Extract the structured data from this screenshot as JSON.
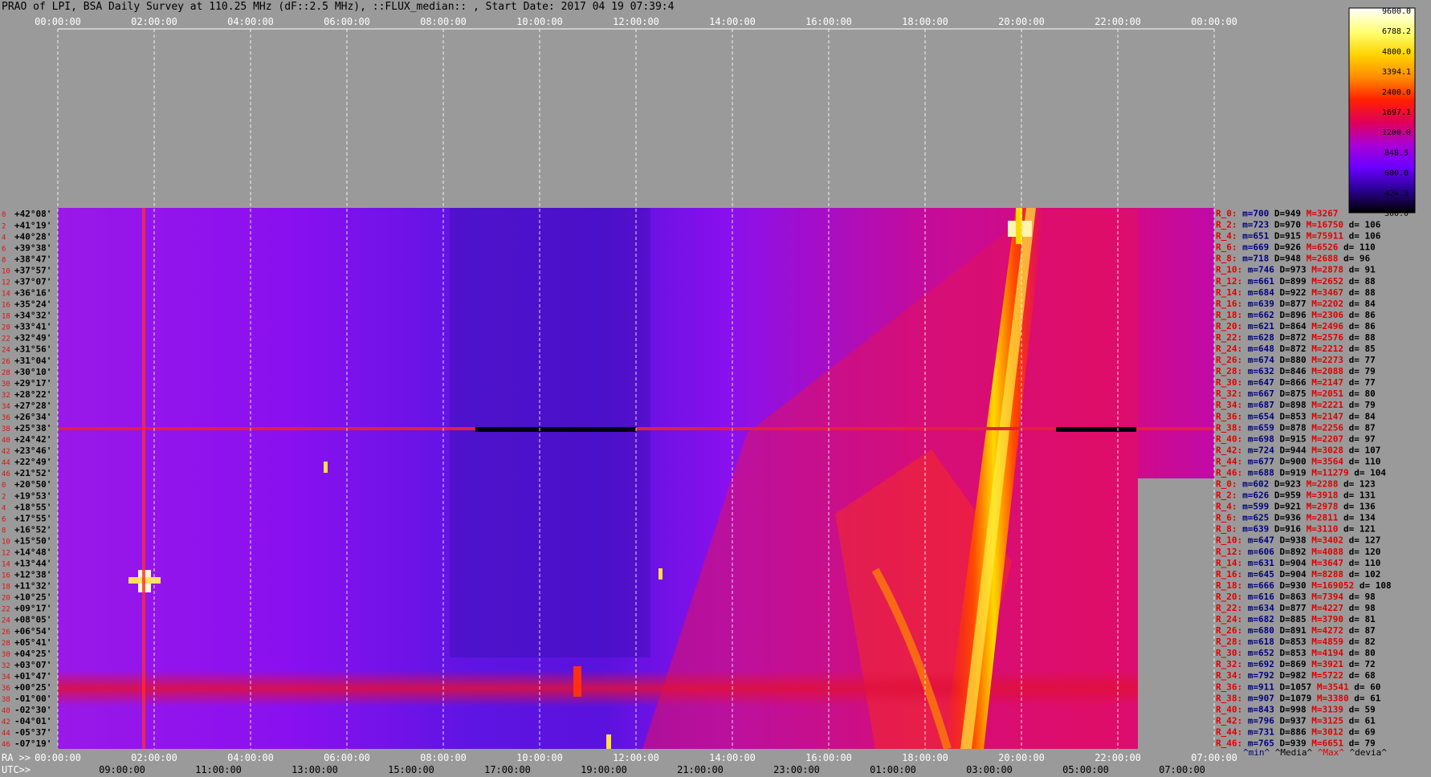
{
  "title": "PRAO of LPI, BSA Daily Survey at 110.25 MHz (dF::2.5 MHz), ::FLUX_median:: , Start Date: 2017 04 19 07:39:4",
  "chart_data": {
    "type": "heatmap",
    "title": "PRAO of LPI, BSA Daily Survey at 110.25 MHz (dF::2.5 MHz), ::FLUX_median:: , Start Date: 2017 04 19 07:39:4",
    "top_axis_ticks": [
      "00:00:00",
      "02:00:00",
      "04:00:00",
      "06:00:00",
      "08:00:00",
      "10:00:00",
      "12:00:00",
      "14:00:00",
      "16:00:00",
      "18:00:00",
      "20:00:00",
      "22:00:00",
      "00:00:00"
    ],
    "ra_label": "RA >>",
    "ra_ticks": [
      "00:00:00",
      "02:00:00",
      "04:00:00",
      "06:00:00",
      "08:00:00",
      "10:00:00",
      "12:00:00",
      "14:00:00",
      "16:00:00",
      "18:00:00",
      "20:00:00",
      "22:00:00",
      "07:00:00"
    ],
    "utc_label": "UTC>>",
    "utc_ticks": [
      "09:00:00",
      "11:00:00",
      "13:00:00",
      "15:00:00",
      "17:00:00",
      "19:00:00",
      "21:00:00",
      "23:00:00",
      "01:00:00",
      "03:00:00",
      "05:00:00",
      "07:00:00"
    ],
    "dec_labels": [
      "+42°08'",
      "+41°19'",
      "+40°28'",
      "+39°38'",
      "+38°47'",
      "+37°57'",
      "+37°07'",
      "+36°16'",
      "+35°24'",
      "+34°32'",
      "+33°41'",
      "+32°49'",
      "+31°56'",
      "+31°04'",
      "+30°10'",
      "+29°17'",
      "+28°22'",
      "+27°28'",
      "+26°34'",
      "+25°38'",
      "+24°42'",
      "+23°46'",
      "+22°49'",
      "+21°52'",
      "+20°50'",
      "+19°53'",
      "+18°55'",
      "+17°55'",
      "+16°52'",
      "+15°50'",
      "+14°48'",
      "+13°44'",
      "+12°38'",
      "+11°32'",
      "+10°25'",
      "+09°17'",
      "+08°05'",
      "+06°54'",
      "+05°41'",
      "+04°25'",
      "+03°07'",
      "+01°47'",
      "+00°25'",
      "-01°00'",
      "-02°30'",
      "-04°01'",
      "-05°37'",
      "-07°19'"
    ],
    "beam_index_labels": [
      "0",
      "2",
      "4",
      "6",
      "8",
      "10",
      "12",
      "14",
      "16",
      "18",
      "20",
      "22",
      "24",
      "26",
      "28",
      "30",
      "32",
      "34",
      "36",
      "38",
      "40",
      "42",
      "44",
      "46",
      "0",
      "2",
      "4",
      "6",
      "8",
      "10",
      "12",
      "14",
      "16",
      "18",
      "20",
      "22",
      "24",
      "26",
      "28",
      "30",
      "32",
      "34",
      "36",
      "38",
      "40",
      "42",
      "44",
      "46"
    ],
    "colorbar_ticks": [
      "9600.0",
      "6788.2",
      "4800.0",
      "3394.1",
      "2400.0",
      "1697.1",
      "1200.0",
      "848.5",
      "600.0",
      "424.3",
      "300.0"
    ],
    "colorbar_colors": [
      "#ffffff",
      "#ffff70",
      "#ffd200",
      "#ff8a00",
      "#ff2000",
      "#e0005a",
      "#a800d8",
      "#6a00ff",
      "#2a0090",
      "#000000"
    ],
    "stats": [
      {
        "r": "R_0:",
        "m": "700",
        "D": "949",
        "M": "3267",
        "d": ""
      },
      {
        "r": "R_2:",
        "m": "723",
        "D": "970",
        "M": "16750",
        "d": "106"
      },
      {
        "r": "R_4:",
        "m": "651",
        "D": "915",
        "M": "75911",
        "d": "106"
      },
      {
        "r": "R_6:",
        "m": "669",
        "D": "926",
        "M": "6526",
        "d": "110"
      },
      {
        "r": "R_8:",
        "m": "718",
        "D": "948",
        "M": "2688",
        "d": "96"
      },
      {
        "r": "R_10:",
        "m": "746",
        "D": "973",
        "M": "2878",
        "d": "91"
      },
      {
        "r": "R_12:",
        "m": "661",
        "D": "899",
        "M": "2652",
        "d": "88"
      },
      {
        "r": "R_14:",
        "m": "684",
        "D": "922",
        "M": "3467",
        "d": "88"
      },
      {
        "r": "R_16:",
        "m": "639",
        "D": "877",
        "M": "2202",
        "d": "84"
      },
      {
        "r": "R_18:",
        "m": "662",
        "D": "896",
        "M": "2306",
        "d": "86"
      },
      {
        "r": "R_20:",
        "m": "621",
        "D": "864",
        "M": "2496",
        "d": "86"
      },
      {
        "r": "R_22:",
        "m": "628",
        "D": "872",
        "M": "2576",
        "d": "88"
      },
      {
        "r": "R_24:",
        "m": "648",
        "D": "872",
        "M": "2212",
        "d": "85"
      },
      {
        "r": "R_26:",
        "m": "674",
        "D": "880",
        "M": "2273",
        "d": "77"
      },
      {
        "r": "R_28:",
        "m": "632",
        "D": "846",
        "M": "2088",
        "d": "79"
      },
      {
        "r": "R_30:",
        "m": "647",
        "D": "866",
        "M": "2147",
        "d": "77"
      },
      {
        "r": "R_32:",
        "m": "667",
        "D": "875",
        "M": "2051",
        "d": "80"
      },
      {
        "r": "R_34:",
        "m": "687",
        "D": "898",
        "M": "2221",
        "d": "79"
      },
      {
        "r": "R_36:",
        "m": "654",
        "D": "853",
        "M": "2147",
        "d": "84"
      },
      {
        "r": "R_38:",
        "m": "659",
        "D": "878",
        "M": "2256",
        "d": "87"
      },
      {
        "r": "R_40:",
        "m": "698",
        "D": "915",
        "M": "2207",
        "d": "97"
      },
      {
        "r": "R_42:",
        "m": "724",
        "D": "944",
        "M": "3028",
        "d": "107"
      },
      {
        "r": "R_44:",
        "m": "677",
        "D": "900",
        "M": "3564",
        "d": "110"
      },
      {
        "r": "R_46:",
        "m": "688",
        "D": "919",
        "M": "11279",
        "d": "104"
      },
      {
        "r": "R_0:",
        "m": "602",
        "D": "923",
        "M": "2288",
        "d": "123"
      },
      {
        "r": "R_2:",
        "m": "626",
        "D": "959",
        "M": "3918",
        "d": "131"
      },
      {
        "r": "R_4:",
        "m": "599",
        "D": "921",
        "M": "2978",
        "d": "136"
      },
      {
        "r": "R_6:",
        "m": "625",
        "D": "936",
        "M": "2811",
        "d": "134"
      },
      {
        "r": "R_8:",
        "m": "639",
        "D": "916",
        "M": "3110",
        "d": "121"
      },
      {
        "r": "R_10:",
        "m": "647",
        "D": "938",
        "M": "3402",
        "d": "127"
      },
      {
        "r": "R_12:",
        "m": "606",
        "D": "892",
        "M": "4088",
        "d": "120"
      },
      {
        "r": "R_14:",
        "m": "631",
        "D": "904",
        "M": "3647",
        "d": "110"
      },
      {
        "r": "R_16:",
        "m": "645",
        "D": "904",
        "M": "8288",
        "d": "102"
      },
      {
        "r": "R_18:",
        "m": "666",
        "D": "930",
        "M": "169052",
        "d": "108"
      },
      {
        "r": "R_20:",
        "m": "616",
        "D": "863",
        "M": "7394",
        "d": "98"
      },
      {
        "r": "R_22:",
        "m": "634",
        "D": "877",
        "M": "4227",
        "d": "98"
      },
      {
        "r": "R_24:",
        "m": "682",
        "D": "885",
        "M": "3790",
        "d": "81"
      },
      {
        "r": "R_26:",
        "m": "680",
        "D": "891",
        "M": "4272",
        "d": "87"
      },
      {
        "r": "R_28:",
        "m": "618",
        "D": "853",
        "M": "4859",
        "d": "82"
      },
      {
        "r": "R_30:",
        "m": "652",
        "D": "853",
        "M": "4194",
        "d": "80"
      },
      {
        "r": "R_32:",
        "m": "692",
        "D": "869",
        "M": "3921",
        "d": "72"
      },
      {
        "r": "R_34:",
        "m": "792",
        "D": "982",
        "M": "5722",
        "d": "68"
      },
      {
        "r": "R_36:",
        "m": "911",
        "D": "1057",
        "M": "3541",
        "d": "60"
      },
      {
        "r": "R_38:",
        "m": "907",
        "D": "1079",
        "M": "3380",
        "d": "61"
      },
      {
        "r": "R_40:",
        "m": "843",
        "D": "998",
        "M": "3139",
        "d": "59"
      },
      {
        "r": "R_42:",
        "m": "796",
        "D": "937",
        "M": "3125",
        "d": "61"
      },
      {
        "r": "R_44:",
        "m": "731",
        "D": "886",
        "M": "3012",
        "d": "69"
      },
      {
        "r": "R_46:",
        "m": "765",
        "D": "939",
        "M": "6651",
        "d": "79"
      }
    ],
    "stats_footer": [
      "^min^",
      "^Media^",
      "^Max^",
      "^devia^"
    ]
  }
}
